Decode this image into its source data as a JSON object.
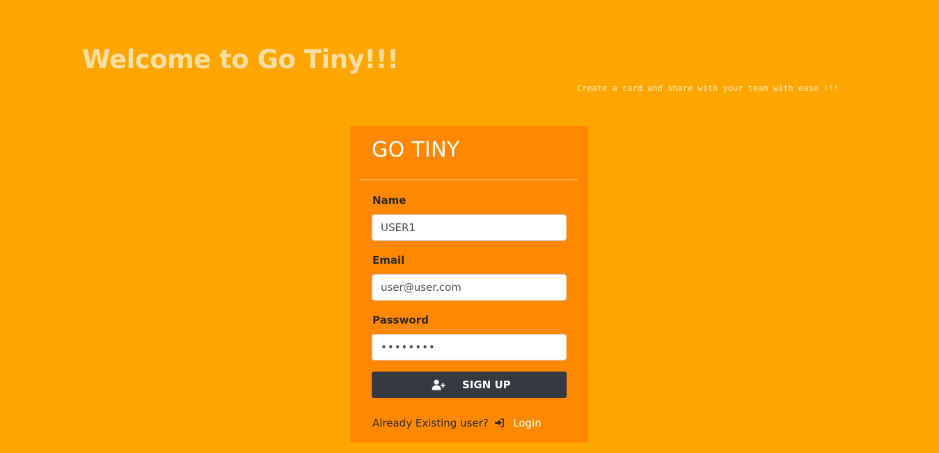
{
  "header": {
    "welcome_title": "Welcome to Go Tiny!!!",
    "tagline": "Create a card and share with your team with ease !!!"
  },
  "card": {
    "title": "GO TINY",
    "fields": {
      "name": {
        "label": "Name",
        "value": "USER1"
      },
      "email": {
        "label": "Email",
        "value": "user@user.com"
      },
      "password": {
        "label": "Password",
        "value": "••••••••"
      }
    },
    "signup_button": {
      "label": "SIGN UP",
      "icon": "user-plus-icon"
    },
    "footer": {
      "prompt": "Already Existing user?",
      "login_icon": "sign-in-icon",
      "login_label": "Login"
    }
  },
  "colors": {
    "page_background": "#FFA500",
    "card_background": "#FF8800",
    "button_background": "#343A40",
    "welcome_text": "#F7DEA2"
  }
}
